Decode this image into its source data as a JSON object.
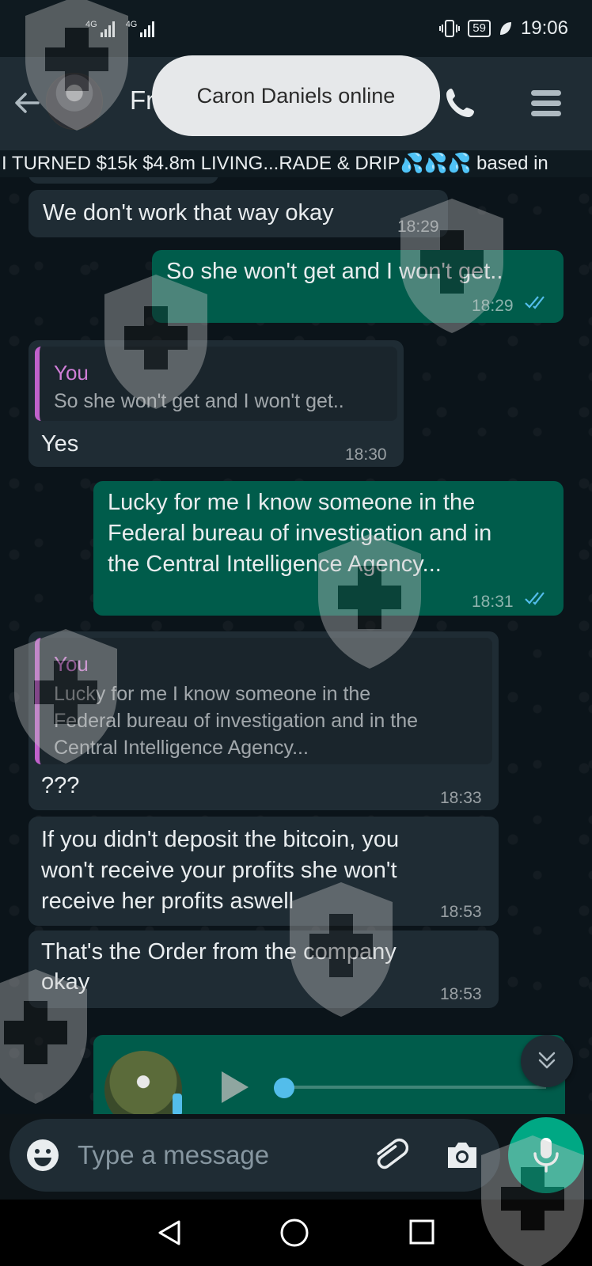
{
  "status_bar": {
    "signal1_label": "4G",
    "signal2_label": "4G",
    "battery": "59",
    "time": "19:06"
  },
  "header": {
    "contact_name": "Frankie",
    "toast": "Caron Daniels online",
    "banner": "I TURNED $15k  $4.8m LIVING...RADE & DRIP💦💦💦  based in"
  },
  "messages": [
    {
      "id": "m1",
      "type": "incoming",
      "text": "We don't work that way okay",
      "time": "18:29"
    },
    {
      "id": "m2",
      "type": "outgoing",
      "text": "So she won't get and I won't get..",
      "time": "18:29"
    },
    {
      "id": "m3",
      "type": "incoming",
      "quote_author": "You",
      "quote_text": "So she won't get and I won't get..",
      "text": "Yes",
      "time": "18:30"
    },
    {
      "id": "m4",
      "type": "outgoing",
      "lines": [
        "Lucky for me I know someone in the",
        "Federal bureau of investigation and in",
        "the Central Intelligence Agency..."
      ],
      "time": "18:31"
    },
    {
      "id": "m5",
      "type": "incoming",
      "quote_author": "You",
      "quote_lines": [
        "Lucky for me I know someone in the",
        "Federal bureau of investigation and in the",
        "Central Intelligence Agency..."
      ],
      "text": "???",
      "time": "18:33"
    },
    {
      "id": "m6",
      "type": "incoming",
      "lines": [
        "If you didn't deposit the bitcoin, you",
        "won't receive your profits she won't",
        "receive her profits aswell"
      ],
      "time": "18:53"
    },
    {
      "id": "m7",
      "type": "incoming",
      "lines": [
        "That's the Order from the company",
        "okay"
      ],
      "time": "18:53"
    }
  ],
  "composer": {
    "placeholder": "Type a message"
  },
  "colors": {
    "header": "#1f2c34",
    "incoming_bubble": "#1f2c34",
    "outgoing_bubble": "#005c4b",
    "accent": "#00a884",
    "quote_bar": "#c061cb",
    "read_ticks": "#53bdeb"
  },
  "icons": [
    "back-arrow-icon",
    "call-icon",
    "menu-icon",
    "emoji-icon",
    "attach-icon",
    "camera-icon",
    "mic-icon",
    "play-icon",
    "chevron-down-icon",
    "nav-back-icon",
    "nav-home-icon",
    "nav-recent-icon"
  ]
}
